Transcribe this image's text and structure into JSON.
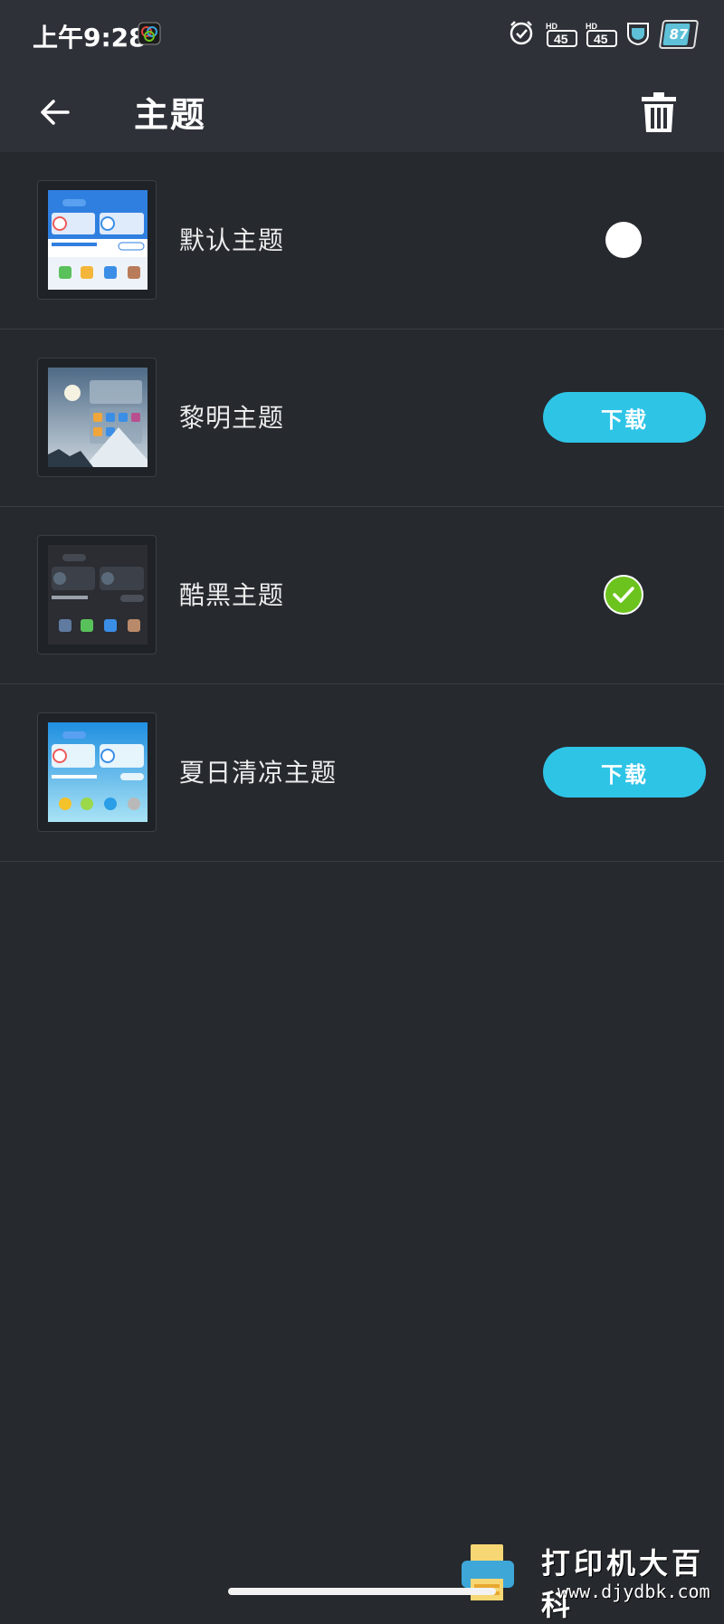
{
  "status_bar": {
    "time": "上午9:28",
    "battery_level": "87",
    "battery_fraction": 0.87,
    "icons": [
      "alarm-icon",
      "hd-4g-signal-icon",
      "hd-4g-signal-icon",
      "shield-app-icon",
      "battery-icon"
    ]
  },
  "app_bar": {
    "title": "主题",
    "back_icon": "arrow-left-icon",
    "delete_icon": "trash-icon"
  },
  "themes": [
    {
      "name": "默认主题",
      "status": "unselected"
    },
    {
      "name": "黎明主题",
      "status": "download",
      "action_label": "下载"
    },
    {
      "name": "酷黑主题",
      "status": "selected"
    },
    {
      "name": "夏日清凉主题",
      "status": "download",
      "action_label": "下载"
    }
  ],
  "colors": {
    "background": "#26292e",
    "app_bar": "#2e3138",
    "accent_button": "#2ec4e6",
    "selected_check": "#6cc31e"
  },
  "watermark": {
    "title": "打印机大百科",
    "url": "www.djydbk.com"
  }
}
